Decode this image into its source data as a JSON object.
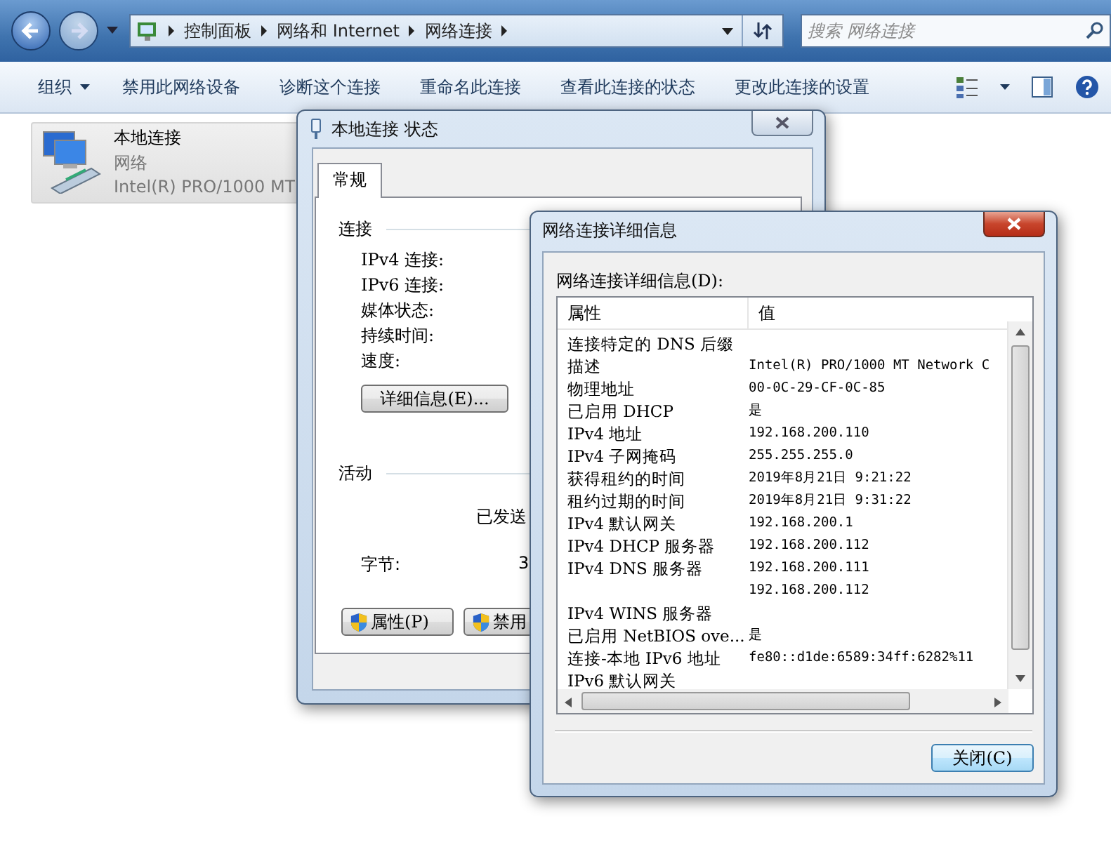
{
  "explorer": {
    "breadcrumb": [
      "控制面板",
      "网络和 Internet",
      "网络连接"
    ],
    "search": {
      "placeholder": "搜索 网络连接"
    },
    "toolbar": {
      "menu": "组织",
      "commands": [
        "禁用此网络设备",
        "诊断这个连接",
        "重命名此连接",
        "查看此连接的状态",
        "更改此连接的设置"
      ]
    },
    "connections": [
      {
        "name": "本地连接",
        "network": "网络",
        "adapter": "Intel(R) PRO/1000 MT",
        "selected": true
      }
    ]
  },
  "status_window": {
    "title": "本地连接 状态",
    "tabs": [
      {
        "label": "常规",
        "selected": true
      }
    ],
    "connection": {
      "heading": "连接",
      "fields": [
        "IPv4 连接:",
        "IPv6 连接:",
        "媒体状态:",
        "持续时间:",
        "速度:"
      ],
      "details_button": "详细信息(E)..."
    },
    "activity": {
      "heading": "活动",
      "sent_header": "已发送",
      "bytes_label": "字节:",
      "bytes_sent": "3"
    },
    "buttons": [
      "属性(P)",
      "禁用"
    ]
  },
  "details_window": {
    "title": "网络连接详细信息",
    "list_label": "网络连接详细信息(D):",
    "columns": [
      "属性",
      "值"
    ],
    "rows": [
      {
        "property": "连接特定的 DNS 后缀"
      },
      {
        "property": "描述",
        "value": "Intel(R) PRO/1000 MT Network C"
      },
      {
        "property": "物理地址",
        "value": "00-0C-29-CF-0C-85"
      },
      {
        "property": "已启用 DHCP",
        "value": "是"
      },
      {
        "property": "IPv4 地址",
        "value": "192.168.200.110"
      },
      {
        "property": "IPv4 子网掩码",
        "value": "255.255.255.0"
      },
      {
        "property": "获得租约的时间",
        "value": "2019年8月21日 9:21:22"
      },
      {
        "property": "租约过期的时间",
        "value": "2019年8月21日 9:31:22"
      },
      {
        "property": "IPv4 默认网关",
        "value": "192.168.200.1"
      },
      {
        "property": "IPv4 DHCP 服务器",
        "value": "192.168.200.112"
      },
      {
        "property": "IPv4 DNS 服务器",
        "value": "192.168.200.111"
      },
      {
        "value": "192.168.200.112"
      },
      {
        "property": "IPv4 WINS 服务器"
      },
      {
        "property": "已启用 NetBIOS ove...",
        "value": "是"
      },
      {
        "property": "连接-本地 IPv6 地址",
        "value": "fe80::d1de:6589:34ff:6282%11"
      },
      {
        "property": "IPv6 默认网关"
      }
    ],
    "close_button": "关闭(C)"
  }
}
